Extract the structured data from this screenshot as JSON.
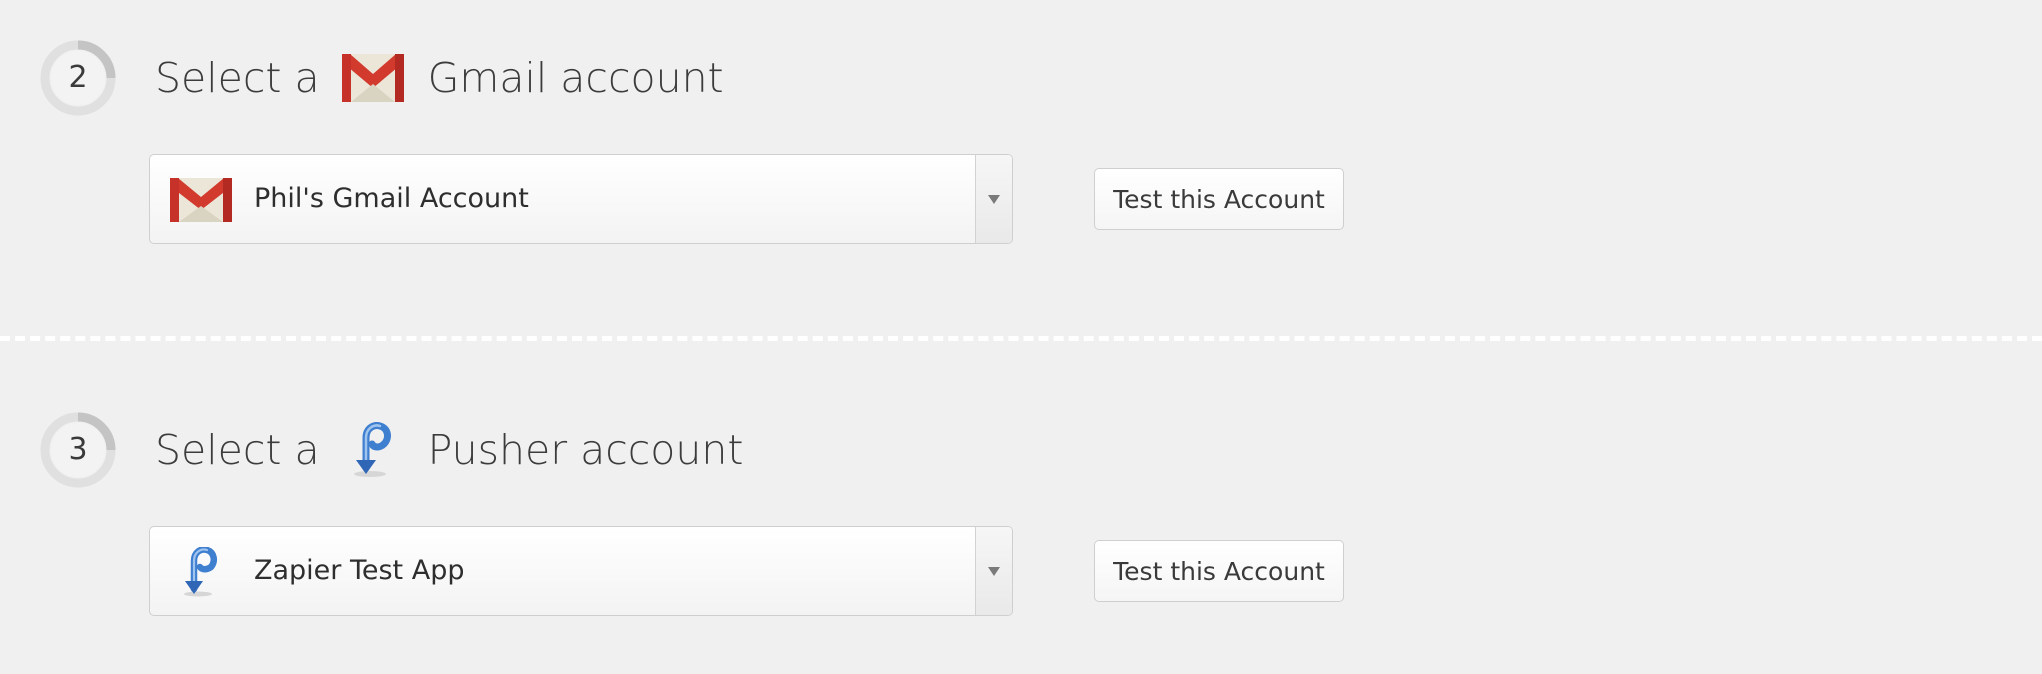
{
  "steps": [
    {
      "number": "2",
      "title_prefix": "Select a",
      "title_suffix": "Gmail account",
      "app_icon": "gmail-icon",
      "selected_account": "Phil's Gmail Account",
      "test_button_label": "Test this Account",
      "progress_fraction": 0.25
    },
    {
      "number": "3",
      "title_prefix": "Select a",
      "title_suffix": "Pusher account",
      "app_icon": "pusher-icon",
      "selected_account": "Zapier Test App",
      "test_button_label": "Test this Account",
      "progress_fraction": 0.25
    }
  ],
  "colors": {
    "background": "#f0f0f0",
    "ring_track": "#e0e0e0",
    "ring_progress": "#c4c4c4",
    "gmail_red": "#d23a2d",
    "pusher_blue": "#3f7fd0",
    "divider": "#ffffff"
  }
}
